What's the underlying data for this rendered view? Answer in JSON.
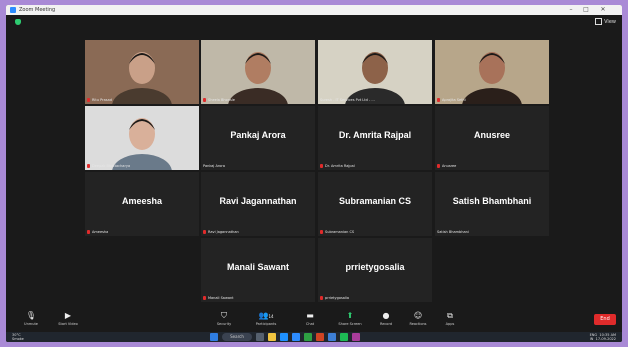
{
  "window": {
    "title": "Zoom Meeting"
  },
  "top": {
    "view_label": "View"
  },
  "participants": [
    {
      "name": "",
      "caption": "Ritu Prasad",
      "video": true,
      "muted": true
    },
    {
      "name": "",
      "caption": "Sheela Bhonsle",
      "video": true,
      "muted": true
    },
    {
      "name": "",
      "caption": "Suresh - IT Services Pvt Ltd - ...",
      "video": true,
      "muted": false,
      "active": true
    },
    {
      "name": "",
      "caption": "Aprajita Sethi",
      "video": true,
      "muted": true
    },
    {
      "name": "",
      "caption": "Deepak Bhattacharya",
      "video": true,
      "muted": true
    },
    {
      "name": "Pankaj Arora",
      "caption": "Pankaj Arora",
      "video": false,
      "muted": false
    },
    {
      "name": "Dr. Amrita Rajpal",
      "caption": "Dr. Amrita Rajpal",
      "video": false,
      "muted": true
    },
    {
      "name": "Anusree",
      "caption": "Anusree",
      "video": false,
      "muted": true
    },
    {
      "name": "Ameesha",
      "caption": "Ameesha",
      "video": false,
      "muted": true
    },
    {
      "name": "Ravi Jagannathan",
      "caption": "Ravi Jagannathan",
      "video": false,
      "muted": true
    },
    {
      "name": "Subramanian CS",
      "caption": "Subramanian CS",
      "video": false,
      "muted": true
    },
    {
      "name": "Satish Bhambhani",
      "caption": "Satish Bhambhani",
      "video": false,
      "muted": false
    },
    {
      "name": "Manali Sawant",
      "caption": "Manali Sawant",
      "video": false,
      "muted": true
    },
    {
      "name": "prrietygosalia",
      "caption": "prrietygosalia",
      "video": false,
      "muted": true
    }
  ],
  "toolbar": {
    "unmute": "Unmute",
    "start_video": "Start Video",
    "security": "Security",
    "participants": "Participants",
    "participants_count": "14",
    "chat": "Chat",
    "share_screen": "Share Screen",
    "record": "Record",
    "reactions": "Reactions",
    "apps": "Apps",
    "end": "End"
  },
  "taskbar": {
    "weather_temp": "30°C",
    "weather_desc": "Smoke",
    "search": "Search",
    "lang": "ENG",
    "lang_region": "IN",
    "time": "10:35 AM",
    "date": "17-09-2022"
  },
  "colors": {
    "active_speaker": "#c6d34a",
    "end_button": "#e02b2b",
    "share_green": "#2ecc71",
    "background": "#1a1a1a"
  }
}
